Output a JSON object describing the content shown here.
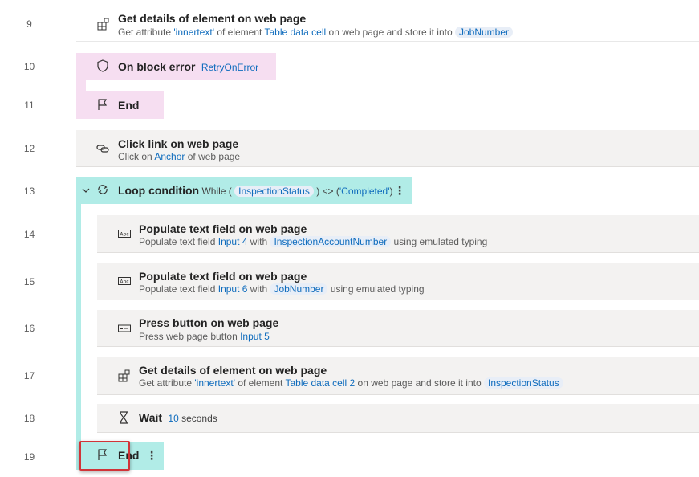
{
  "lines": [
    "9",
    "10",
    "11",
    "12",
    "13",
    "14",
    "15",
    "16",
    "17",
    "18",
    "19"
  ],
  "steps": {
    "s9": {
      "title": "Get details of element on web page",
      "p1": "Get attribute ",
      "attr": "'innertext'",
      "p2": " of element ",
      "element": "Table data cell",
      "p3": " on web page and store it into ",
      "var": "JobNumber",
      "icon": "get-details-icon"
    },
    "s10": {
      "title": "On block error",
      "var": "RetryOnError",
      "icon": "shield-icon"
    },
    "s11": {
      "title": "End",
      "icon": "flag-icon"
    },
    "s12": {
      "title": "Click link on web page",
      "p1": "Click on ",
      "element": "Anchor",
      "p2": " of web page",
      "icon": "link-icon"
    },
    "s13": {
      "title": "Loop condition",
      "p1": "While (",
      "var": "InspectionStatus",
      "p2": ") <> (",
      "value": "'Completed'",
      "p3": ")",
      "icon": "loop-icon",
      "collapse_icon": "chevron-down-icon"
    },
    "s14": {
      "title": "Populate text field on web page",
      "p1": "Populate text field ",
      "element": "Input 4",
      "p2": " with ",
      "var": "InspectionAccountNumber",
      "p3": " using emulated typing",
      "icon": "text-field-icon"
    },
    "s15": {
      "title": "Populate text field on web page",
      "p1": "Populate text field ",
      "element": "Input 6",
      "p2": " with ",
      "var": "JobNumber",
      "p3": " using emulated typing",
      "icon": "text-field-icon"
    },
    "s16": {
      "title": "Press button on web page",
      "p1": "Press web page button ",
      "element": "Input 5",
      "icon": "button-icon"
    },
    "s17": {
      "title": "Get details of element on web page",
      "p1": "Get attribute ",
      "attr": "'innertext'",
      "p2": " of element ",
      "element": "Table data cell 2",
      "p3": " on web page and store it into ",
      "var": "InspectionStatus",
      "icon": "get-details-icon"
    },
    "s18": {
      "title": "Wait",
      "value": "10",
      "p1": " seconds",
      "icon": "hourglass-icon"
    },
    "s19": {
      "title": "End",
      "icon": "flag-icon"
    }
  },
  "menu_icon": "more-vertical-icon",
  "colors": {
    "accent_link": "#0f6cbd",
    "variable_pill": "#e8eef7",
    "error_block": "#f6def1",
    "loop_block": "#b1ece7",
    "action_card": "#f3f2f1",
    "highlight_border": "#d13438"
  }
}
